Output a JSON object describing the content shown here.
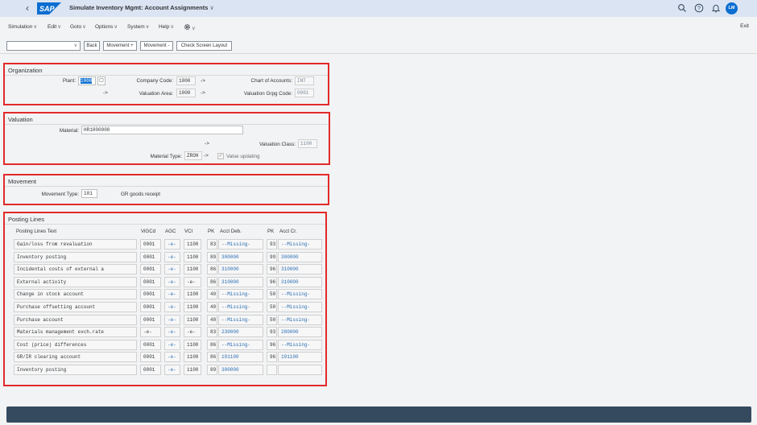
{
  "shell": {
    "title": "Simulate Inventory Mgmt: Account Assignments",
    "logo_text": "SAP",
    "avatar": "LM"
  },
  "menu": {
    "items": [
      "Simulation",
      "Edit",
      "Goto",
      "Options",
      "System",
      "Help"
    ],
    "exit": "Exit"
  },
  "toolbar": {
    "buttons": [
      "Back",
      "Movement +",
      "Movement -",
      "Check Screen Layout"
    ]
  },
  "organization": {
    "title": "Organization",
    "plant_label": "Plant:",
    "plant_value": "1000",
    "company_code_label": "Company Code:",
    "company_code_value": "1000",
    "chart_of_accounts_label": "Chart of Accounts:",
    "chart_of_accounts_value": "INT",
    "valuation_area_label": "Valuation Area:",
    "valuation_area_value": "1000",
    "valuation_grpg_label": "Valuation Grpg Code:",
    "valuation_grpg_value": "0001",
    "arrow": "->"
  },
  "valuation": {
    "title": "Valuation",
    "material_label": "Material:",
    "material_value": "HR1000000",
    "valuation_class_label": "Valuation Class:",
    "valuation_class_value": "1100",
    "material_type_label": "Material Type:",
    "material_type_value": "ZROH",
    "value_updating_label": "Value updating",
    "value_updating_checked": true,
    "arrow": "->"
  },
  "movement": {
    "title": "Movement",
    "movement_type_label": "Movement Type:",
    "movement_type_value": "101",
    "movement_type_text": "GR goods receipt"
  },
  "posting": {
    "title": "Posting Lines",
    "headers": [
      "Posting Lines Text",
      "ViGCd",
      "AGC",
      "VCl",
      "PK",
      "Acct Deb.",
      "PK",
      "Acct Cr."
    ],
    "rows": [
      [
        "Gain/loss from revaluation",
        "0001",
        "-e-",
        "1100",
        "83",
        "--Missing-",
        "93",
        "--Missing-"
      ],
      [
        "Inventory posting",
        "0001",
        "-e-",
        "1100",
        "89",
        "300000",
        "99",
        "300000"
      ],
      [
        "Incidental costs of external a",
        "0001",
        "-e-",
        "1100",
        "86",
        "310000",
        "96",
        "310000"
      ],
      [
        "External activity",
        "0001",
        "-e-",
        "-e-",
        "86",
        "310000",
        "96",
        "310000"
      ],
      [
        "Change in stock account",
        "0001",
        "-e-",
        "1100",
        "40",
        "--Missing-",
        "50",
        "--Missing-"
      ],
      [
        "Purchase offsetting account",
        "0001",
        "-e-",
        "1100",
        "40",
        "--Missing-",
        "50",
        "--Missing-"
      ],
      [
        "Purchase account",
        "0001",
        "-e-",
        "1100",
        "40",
        "--Missing-",
        "50",
        "--Missing-"
      ],
      [
        "Materials management exch.rate",
        "-e-",
        "-e-",
        "-e-",
        "83",
        "230000",
        "93",
        "280000"
      ],
      [
        "Cost (price) differences",
        "0001",
        "-e-",
        "1100",
        "86",
        "--Missing-",
        "96",
        "--Missing-"
      ],
      [
        "GR/IR clearing account",
        "0001",
        "-e-",
        "1100",
        "86",
        "191100",
        "96",
        "191100"
      ],
      [
        "Inventory posting",
        "0001",
        "-e-",
        "1100",
        "89",
        "300000",
        "",
        ""
      ]
    ]
  }
}
